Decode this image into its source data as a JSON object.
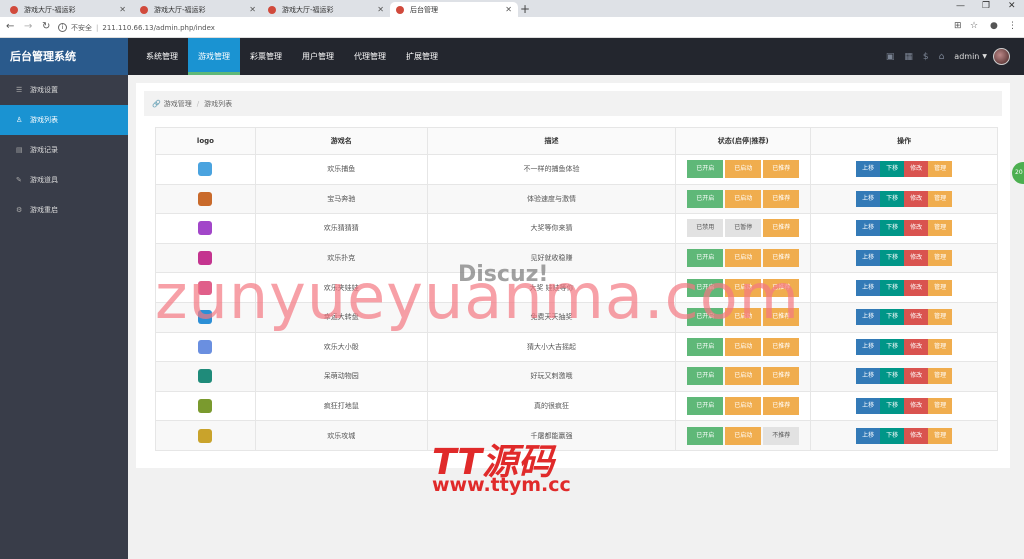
{
  "browser": {
    "tabs": [
      {
        "title": "游戏大厅-福运彩",
        "active": false
      },
      {
        "title": "游戏大厅-福运彩",
        "active": false
      },
      {
        "title": "游戏大厅-福运彩",
        "active": false
      },
      {
        "title": "后台管理",
        "active": true
      }
    ],
    "not_secure": "不安全",
    "url": "211.110.66.13/admin.php/index"
  },
  "header": {
    "app_title": "后台管理系统",
    "nav": [
      "系统管理",
      "游戏管理",
      "彩票管理",
      "用户管理",
      "代理管理",
      "扩展管理"
    ],
    "active_nav": 1,
    "user": "admin"
  },
  "sidebar": {
    "items": [
      {
        "label": "游戏设置",
        "icon": "settings-icon",
        "active": false
      },
      {
        "label": "游戏列表",
        "icon": "user-icon",
        "active": true
      },
      {
        "label": "游戏记录",
        "icon": "record-icon",
        "active": false
      },
      {
        "label": "游戏道具",
        "icon": "tool-icon",
        "active": false
      },
      {
        "label": "游戏重启",
        "icon": "gear-icon",
        "active": false
      }
    ]
  },
  "breadcrumb": {
    "parent": "游戏管理",
    "current": "游戏列表"
  },
  "table": {
    "headers": [
      "logo",
      "游戏名",
      "描述",
      "状态(启停|推荐)",
      "操作"
    ],
    "actions": [
      "上移",
      "下移",
      "修改",
      "管理"
    ],
    "rows": [
      {
        "name": "欢乐捕鱼",
        "desc": "不一样的捕鱼体验",
        "status": [
          "已开启",
          "已启动",
          "已推荐"
        ],
        "status_style": [
          "green",
          "orange",
          "orange"
        ],
        "icon_color": "#4aa3df"
      },
      {
        "name": "宝马奔驰",
        "desc": "体验速度与激情",
        "status": [
          "已开启",
          "已启动",
          "已推荐"
        ],
        "status_style": [
          "green",
          "orange",
          "orange"
        ],
        "icon_color": "#c96a2b"
      },
      {
        "name": "欢乐猜猜猜",
        "desc": "大奖等你来猜",
        "status": [
          "已禁用",
          "已暂停",
          "已推荐"
        ],
        "status_style": [
          "gray",
          "gray",
          "orange"
        ],
        "icon_color": "#a246c9"
      },
      {
        "name": "欢乐扑克",
        "desc": "见好就收稳赚",
        "status": [
          "已开启",
          "已启动",
          "已推荐"
        ],
        "status_style": [
          "green",
          "orange",
          "orange"
        ],
        "icon_color": "#c4348f"
      },
      {
        "name": "欢乐夹娃娃",
        "desc": "大奖 娃娃等你",
        "status": [
          "已开启",
          "已启动",
          "已推荐"
        ],
        "status_style": [
          "green",
          "orange",
          "orange"
        ],
        "icon_color": "#e05f8a"
      },
      {
        "name": "幸运大转盘",
        "desc": "免费天天抽奖",
        "status": [
          "已开启",
          "已启动",
          "已推荐"
        ],
        "status_style": [
          "green",
          "orange",
          "orange"
        ],
        "icon_color": "#2c8fd6"
      },
      {
        "name": "欢乐大小骰",
        "desc": "猜大小大吉摇起",
        "status": [
          "已开启",
          "已启动",
          "已推荐"
        ],
        "status_style": [
          "green",
          "orange",
          "orange"
        ],
        "icon_color": "#6a8fe0"
      },
      {
        "name": "呆萌动物园",
        "desc": "好玩又刺激哦",
        "status": [
          "已开启",
          "已启动",
          "已推荐"
        ],
        "status_style": [
          "green",
          "orange",
          "orange"
        ],
        "icon_color": "#1f8b7a"
      },
      {
        "name": "疯狂打地鼠",
        "desc": "真的很疯狂",
        "status": [
          "已开启",
          "已启动",
          "已推荐"
        ],
        "status_style": [
          "green",
          "orange",
          "orange"
        ],
        "icon_color": "#7a9a2e"
      },
      {
        "name": "欢乐攻城",
        "desc": "千屠都能赢强",
        "status": [
          "已开启",
          "已启动",
          "不推荐"
        ],
        "status_style": [
          "green",
          "orange",
          "gray"
        ],
        "icon_color": "#c9a32b"
      }
    ]
  },
  "watermarks": {
    "discuz": "Discuz!",
    "big": "zunyueyuanma.com",
    "tt_logo": "TT源码",
    "tt_url": "www.ttym.cc"
  },
  "float_button": "20"
}
